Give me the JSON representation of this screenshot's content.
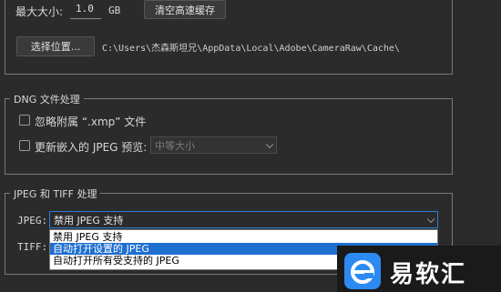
{
  "cache": {
    "max_size_label": "最大大小:",
    "max_size_value": "1.0",
    "max_size_unit": "GB",
    "purge_button": "清空高速缓存",
    "select_location_button": "选择位置...",
    "path": "C:\\Users\\杰森斯坦兄\\AppData\\Local\\Adobe\\CameraRaw\\Cache\\"
  },
  "dng": {
    "legend": "DNG 文件处理",
    "ignore_sidecar_label": "忽略附属 “.xmp” 文件",
    "ignore_sidecar_checked": false,
    "update_preview_label": "更新嵌入的 JPEG 预览:",
    "update_preview_checked": false,
    "preview_size_value": "中等大小"
  },
  "jpeg_tiff": {
    "legend": "JPEG 和 TIFF 处理",
    "jpeg_label": "JPEG:",
    "jpeg_selected": "禁用 JPEG 支持",
    "tiff_label": "TIFF:",
    "options": [
      "禁用 JPEG 支持",
      "自动打开设置的 JPEG",
      "自动打开所有受支持的 JPEG"
    ],
    "highlighted_index": 1
  },
  "watermark": {
    "text": "易软汇"
  },
  "colors": {
    "background": "#2b2b2b",
    "highlight": "#1e6fd0",
    "watermark_blue": "#2c8bf2"
  }
}
